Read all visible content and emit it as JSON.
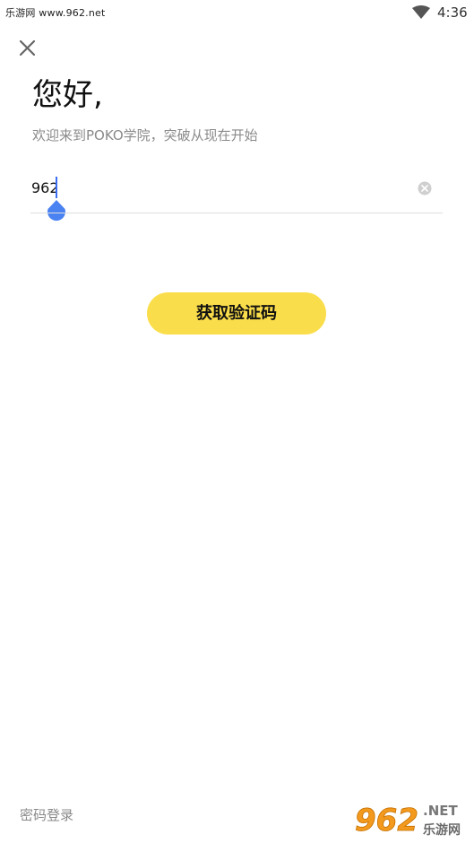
{
  "status_bar": {
    "watermark": "乐游网 www.962.net",
    "time": "4:36"
  },
  "login": {
    "greeting": "您好,",
    "subtitle": "欢迎来到POKO学院，突破从现在开始",
    "phone_value": "962",
    "get_code_label": "获取验证码",
    "password_login_label": "密码登录"
  },
  "watermark_logo": {
    "text_main": "962",
    "text_net": ".NET",
    "text_cn": "乐游网"
  },
  "colors": {
    "button": "#fadd4a",
    "caret": "#3b6ef5",
    "muted_text": "#8a8a8a",
    "logo_orange": "#f39a1e"
  }
}
